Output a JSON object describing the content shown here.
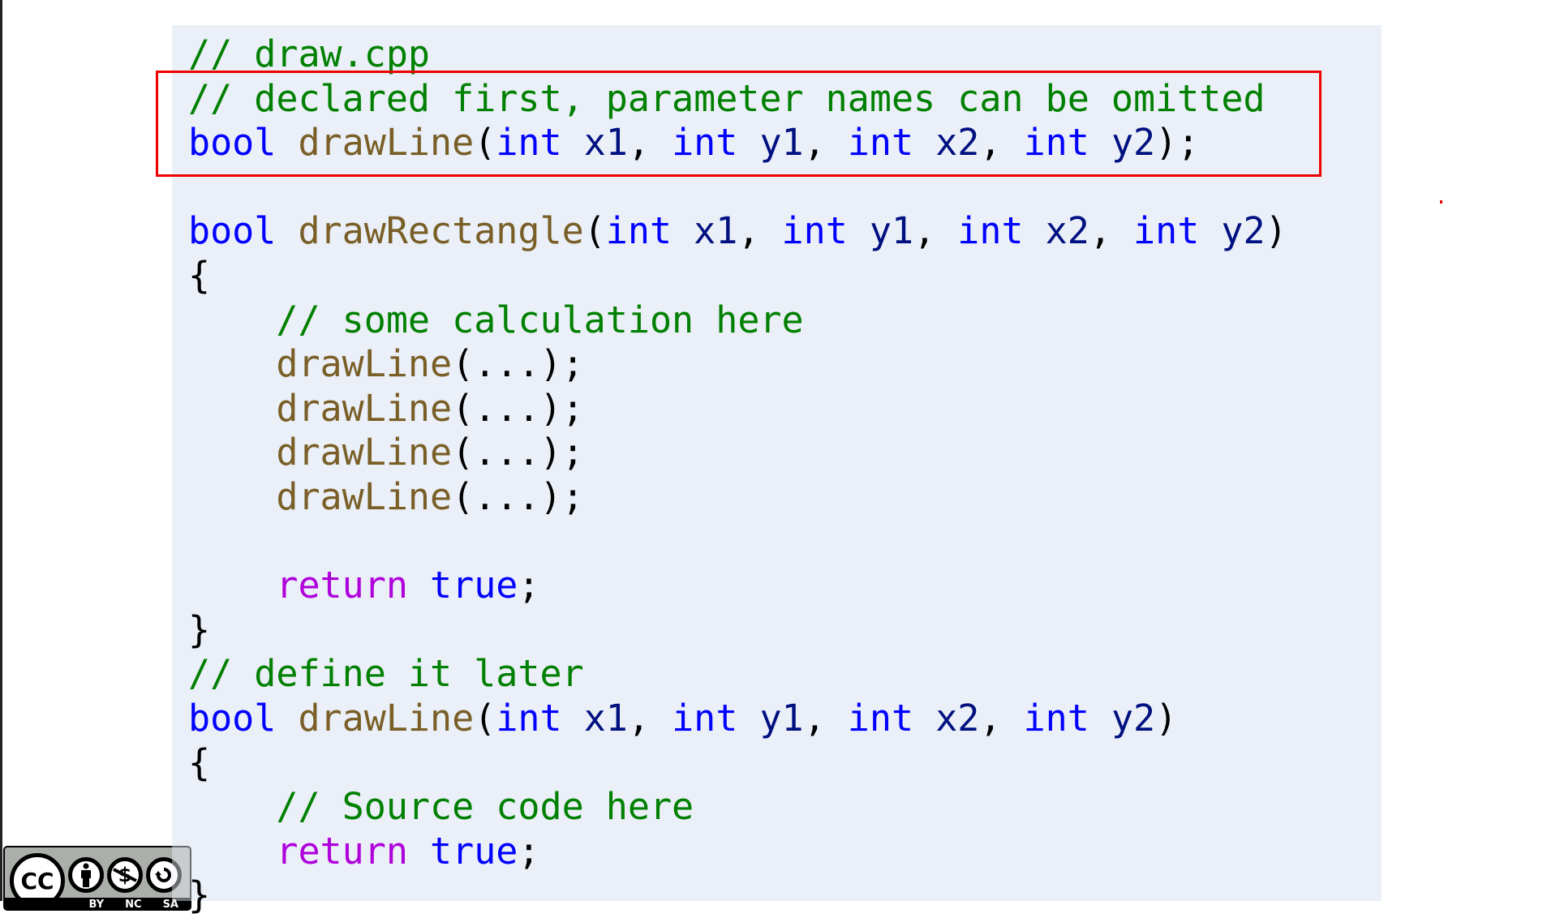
{
  "document": {
    "filename_comment": "// draw.cpp"
  },
  "code": {
    "lines": [
      [
        {
          "t": "// draw.cpp",
          "c": "cm"
        }
      ],
      [
        {
          "t": "// declared first, parameter names can be omitted",
          "c": "cm"
        }
      ],
      [
        {
          "t": "bool",
          "c": "kw"
        },
        {
          "t": " ",
          "c": "pn"
        },
        {
          "t": "drawLine",
          "c": "fn"
        },
        {
          "t": "(",
          "c": "pn"
        },
        {
          "t": "int",
          "c": "kw"
        },
        {
          "t": " ",
          "c": "pn"
        },
        {
          "t": "x1",
          "c": "id"
        },
        {
          "t": ", ",
          "c": "pn"
        },
        {
          "t": "int",
          "c": "kw"
        },
        {
          "t": " ",
          "c": "pn"
        },
        {
          "t": "y1",
          "c": "id"
        },
        {
          "t": ", ",
          "c": "pn"
        },
        {
          "t": "int",
          "c": "kw"
        },
        {
          "t": " ",
          "c": "pn"
        },
        {
          "t": "x2",
          "c": "id"
        },
        {
          "t": ", ",
          "c": "pn"
        },
        {
          "t": "int",
          "c": "kw"
        },
        {
          "t": " ",
          "c": "pn"
        },
        {
          "t": "y2",
          "c": "id"
        },
        {
          "t": ");",
          "c": "pn"
        }
      ],
      [],
      [
        {
          "t": "bool",
          "c": "kw"
        },
        {
          "t": " ",
          "c": "pn"
        },
        {
          "t": "drawRectangle",
          "c": "fn"
        },
        {
          "t": "(",
          "c": "pn"
        },
        {
          "t": "int",
          "c": "kw"
        },
        {
          "t": " ",
          "c": "pn"
        },
        {
          "t": "x1",
          "c": "id"
        },
        {
          "t": ", ",
          "c": "pn"
        },
        {
          "t": "int",
          "c": "kw"
        },
        {
          "t": " ",
          "c": "pn"
        },
        {
          "t": "y1",
          "c": "id"
        },
        {
          "t": ", ",
          "c": "pn"
        },
        {
          "t": "int",
          "c": "kw"
        },
        {
          "t": " ",
          "c": "pn"
        },
        {
          "t": "x2",
          "c": "id"
        },
        {
          "t": ", ",
          "c": "pn"
        },
        {
          "t": "int",
          "c": "kw"
        },
        {
          "t": " ",
          "c": "pn"
        },
        {
          "t": "y2",
          "c": "id"
        },
        {
          "t": ")",
          "c": "pn"
        }
      ],
      [
        {
          "t": "{",
          "c": "pn"
        }
      ],
      [
        {
          "t": "    ",
          "c": "pn"
        },
        {
          "t": "// some calculation here",
          "c": "cm"
        }
      ],
      [
        {
          "t": "    ",
          "c": "pn"
        },
        {
          "t": "drawLine",
          "c": "fn"
        },
        {
          "t": "(...);",
          "c": "pn"
        }
      ],
      [
        {
          "t": "    ",
          "c": "pn"
        },
        {
          "t": "drawLine",
          "c": "fn"
        },
        {
          "t": "(...);",
          "c": "pn"
        }
      ],
      [
        {
          "t": "    ",
          "c": "pn"
        },
        {
          "t": "drawLine",
          "c": "fn"
        },
        {
          "t": "(...);",
          "c": "pn"
        }
      ],
      [
        {
          "t": "    ",
          "c": "pn"
        },
        {
          "t": "drawLine",
          "c": "fn"
        },
        {
          "t": "(...);",
          "c": "pn"
        }
      ],
      [],
      [
        {
          "t": "    ",
          "c": "pn"
        },
        {
          "t": "return",
          "c": "ctl"
        },
        {
          "t": " ",
          "c": "pn"
        },
        {
          "t": "true",
          "c": "kw"
        },
        {
          "t": ";",
          "c": "pn"
        }
      ],
      [
        {
          "t": "}",
          "c": "pn"
        }
      ],
      [
        {
          "t": "// define it later",
          "c": "cm"
        }
      ],
      [
        {
          "t": "bool",
          "c": "kw"
        },
        {
          "t": " ",
          "c": "pn"
        },
        {
          "t": "drawLine",
          "c": "fn"
        },
        {
          "t": "(",
          "c": "pn"
        },
        {
          "t": "int",
          "c": "kw"
        },
        {
          "t": " ",
          "c": "pn"
        },
        {
          "t": "x1",
          "c": "id"
        },
        {
          "t": ", ",
          "c": "pn"
        },
        {
          "t": "int",
          "c": "kw"
        },
        {
          "t": " ",
          "c": "pn"
        },
        {
          "t": "y1",
          "c": "id"
        },
        {
          "t": ", ",
          "c": "pn"
        },
        {
          "t": "int",
          "c": "kw"
        },
        {
          "t": " ",
          "c": "pn"
        },
        {
          "t": "x2",
          "c": "id"
        },
        {
          "t": ", ",
          "c": "pn"
        },
        {
          "t": "int",
          "c": "kw"
        },
        {
          "t": " ",
          "c": "pn"
        },
        {
          "t": "y2",
          "c": "id"
        },
        {
          "t": ")",
          "c": "pn"
        }
      ],
      [
        {
          "t": "{",
          "c": "pn"
        }
      ],
      [
        {
          "t": "    ",
          "c": "pn"
        },
        {
          "t": "// Source code here",
          "c": "cm"
        }
      ],
      [
        {
          "t": "    ",
          "c": "pn"
        },
        {
          "t": "return",
          "c": "ctl"
        },
        {
          "t": " ",
          "c": "pn"
        },
        {
          "t": "true",
          "c": "kw"
        },
        {
          "t": ";",
          "c": "pn"
        }
      ],
      [
        {
          "t": "}",
          "c": "pn"
        }
      ]
    ],
    "highlighted_lines": [
      2,
      3
    ]
  },
  "license_badge": {
    "main_icon": "CC",
    "icons": [
      "by-person-icon",
      "nc-no-dollar-icon",
      "sa-share-alike-icon"
    ],
    "labels": [
      "BY",
      "NC",
      "SA"
    ]
  },
  "colors": {
    "comment": "#008000",
    "keyword": "#0000ff",
    "function": "#795e26",
    "identifier": "#001080",
    "control": "#af00db",
    "panel_bg": "#eaeff8",
    "highlight_border": "#ee0000"
  }
}
